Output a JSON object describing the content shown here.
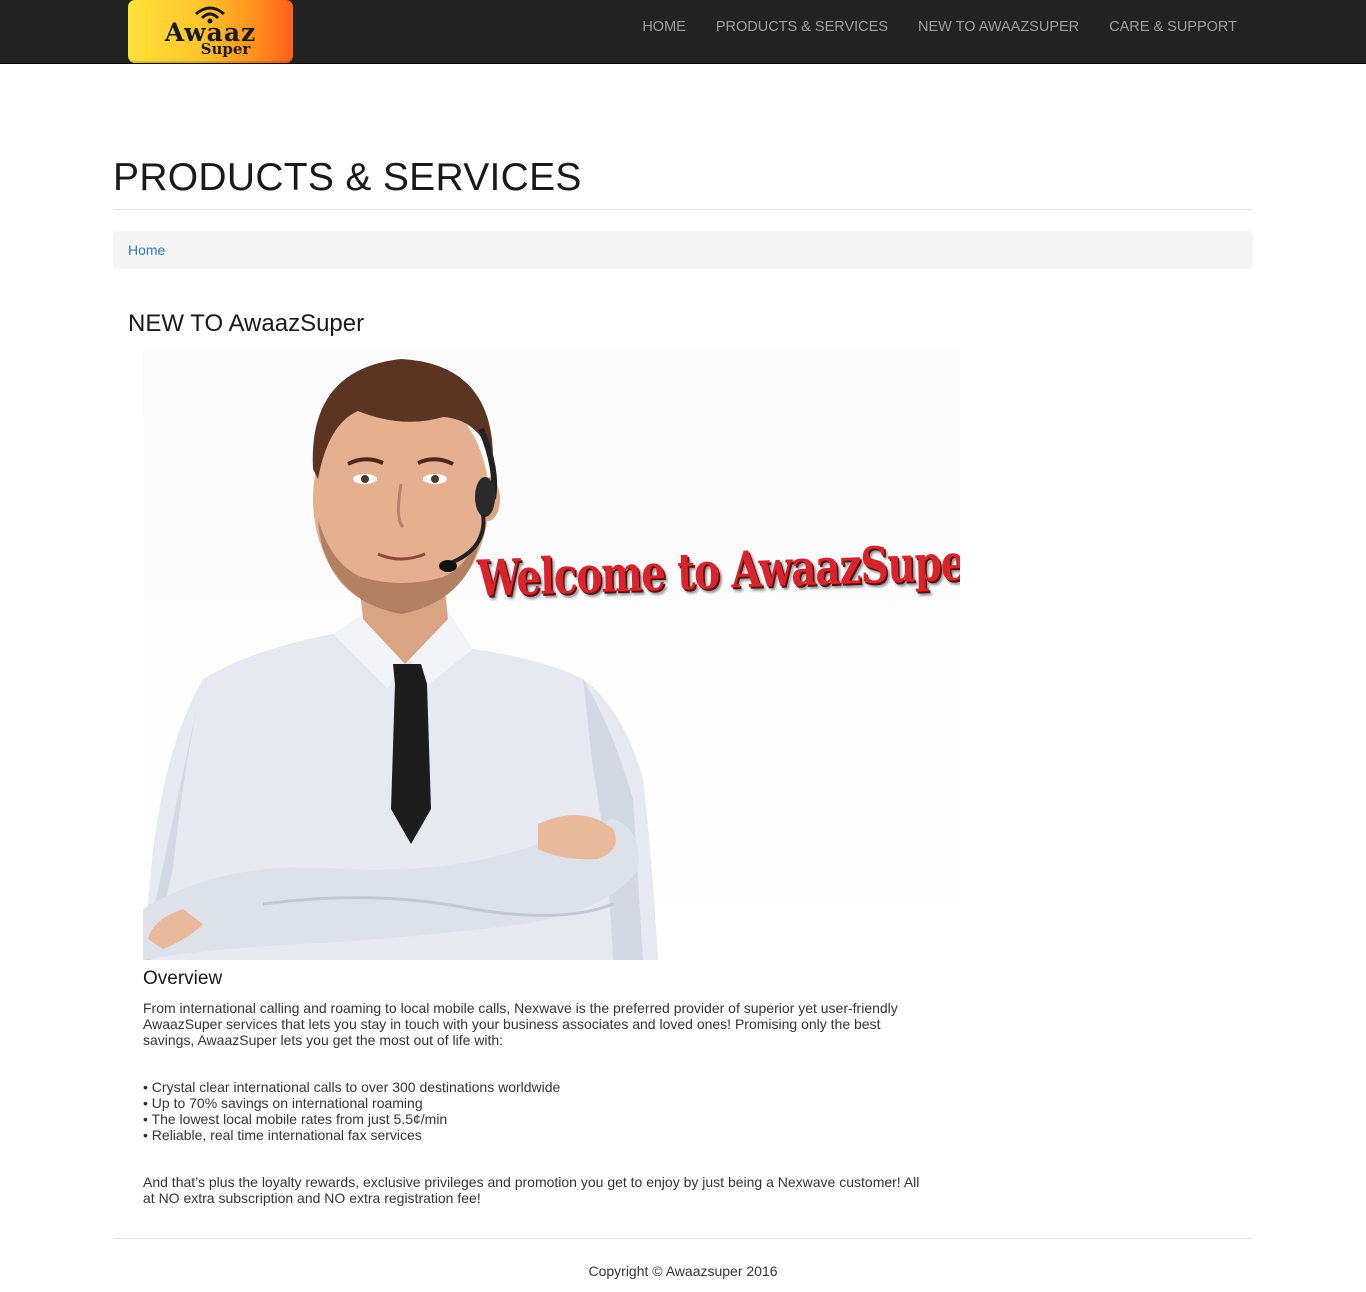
{
  "brand": {
    "logo_main": "Awaaz",
    "logo_sub": "Super"
  },
  "nav": {
    "items": [
      "HOME",
      "PRODUCTS & SERVICES",
      "NEW TO AWAAZSUPER",
      "CARE & SUPPORT"
    ]
  },
  "page": {
    "title": "PRODUCTS & SERVICES",
    "breadcrumb": "Home",
    "section_title": "NEW TO AwaazSuper"
  },
  "hero": {
    "welcome_text": "Welcome to AwaazSuper"
  },
  "overview": {
    "title": "Overview",
    "intro": "From international calling and roaming to local mobile calls, Nexwave is the preferred provider of superior yet user-friendly AwaazSuper services that lets you stay in touch with your business associates and loved ones! Promising only the best savings, AwaazSuper lets you get the most out of life with:",
    "bullets": [
      "• Crystal clear international calls to over 300 destinations worldwide",
      "• Up to 70% savings on international roaming",
      "• The lowest local mobile rates from just 5.5¢/min",
      "• Reliable, real time international fax services"
    ],
    "closing": "And that’s plus the loyalty rewards, exclusive privileges and promotion you get to enjoy by just being a Nexwave customer! All at NO extra subscription and NO extra registration fee!"
  },
  "footer": {
    "copyright": "Copyright © Awaazsuper 2016"
  }
}
